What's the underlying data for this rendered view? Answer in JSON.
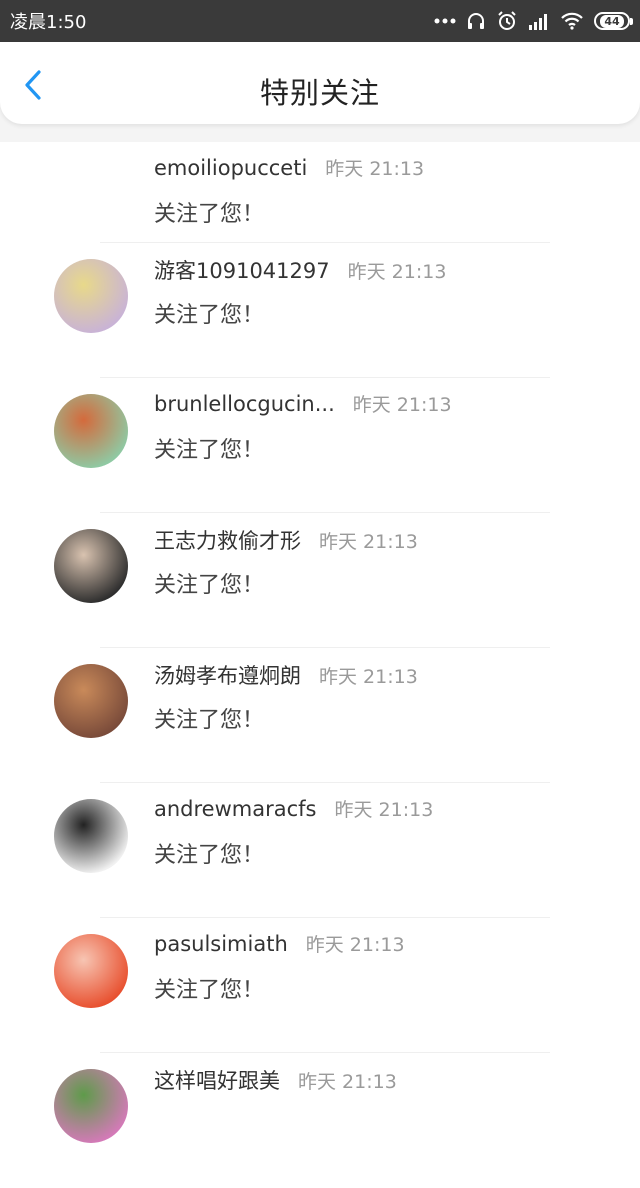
{
  "status_bar": {
    "time": "凌晨1:50",
    "battery": "44",
    "icons": [
      "more-dots-icon",
      "headset-icon",
      "alarm-icon",
      "signal-icon",
      "wifi-icon",
      "battery-icon"
    ]
  },
  "header": {
    "title": "特别关注",
    "back_icon": "chevron-left-icon",
    "accent": "#2196f3"
  },
  "items": [
    {
      "name": "emoilio­pucceti",
      "time": "昨天 21:13",
      "message": "关注了您！",
      "has_avatar": false
    },
    {
      "name": "游客1091041297",
      "time": "昨天 21:13",
      "message": "关注了您！",
      "has_avatar": true,
      "avatar_colors": [
        "#c9b3d6",
        "#e8d98a"
      ]
    },
    {
      "name": "brunlellocgucin...",
      "time": "昨天 21:13",
      "message": "关注了您！",
      "has_avatar": true,
      "avatar_colors": [
        "#8fc9a3",
        "#d46a3c"
      ]
    },
    {
      "name": "王志力救偷才形",
      "time": "昨天 21:13",
      "message": "关注了您！",
      "has_avatar": true,
      "avatar_colors": [
        "#2e2e2e",
        "#d9c3b0"
      ]
    },
    {
      "name": "汤姆孝布遵炯朗",
      "time": "昨天 21:13",
      "message": "关注了您！",
      "has_avatar": true,
      "avatar_colors": [
        "#7a4b3a",
        "#c98a5a"
      ]
    },
    {
      "name": "andrewmaracfs",
      "time": "昨天 21:13",
      "message": "关注了您！",
      "has_avatar": true,
      "avatar_colors": [
        "#f1f1f1",
        "#222222"
      ]
    },
    {
      "name": "pasulsimiath",
      "time": "昨天 21:13",
      "message": "关注了您！",
      "has_avatar": true,
      "avatar_colors": [
        "#e8502f",
        "#f7c5b3"
      ]
    },
    {
      "name": "这样唱好跟美",
      "time": "昨天 21:13",
      "message": "",
      "has_avatar": true,
      "avatar_colors": [
        "#d47ab8",
        "#5e9b4a"
      ]
    }
  ]
}
